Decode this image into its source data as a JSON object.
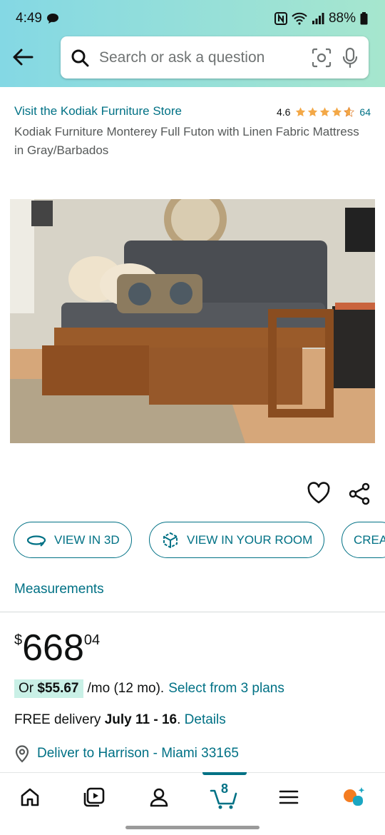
{
  "status_bar": {
    "time": "4:49",
    "battery": "88%"
  },
  "search": {
    "placeholder": "Search or ask a question"
  },
  "product": {
    "store_link": "Visit the Kodiak Furniture Store",
    "rating": "4.6",
    "rating_value": 4.6,
    "rating_count": "64",
    "title": "Kodiak Furniture Monterey Full Futon with Linen Fabric Mattress in Gray/Barbados"
  },
  "actions": {
    "view_3d": "VIEW IN 3D",
    "view_room": "VIEW IN YOUR ROOM",
    "create": "CREA"
  },
  "measurements": "Measurements",
  "price": {
    "symbol": "$",
    "whole": "668",
    "fraction": "04"
  },
  "monthly": {
    "prefix": "Or",
    "amount": "$55.67",
    "term": "/mo (12 mo).",
    "plans_link": "Select from 3 plans"
  },
  "delivery": {
    "label": "FREE delivery",
    "dates": "July 11 - 16",
    "details_link": "Details"
  },
  "deliver_to": "Deliver to Harrison - Miami 33165",
  "nav": {
    "cart_count": "8"
  },
  "colors": {
    "link": "#007185",
    "star": "#f3a847",
    "header_start": "#84d8e4",
    "header_end": "#a6e6ce"
  }
}
